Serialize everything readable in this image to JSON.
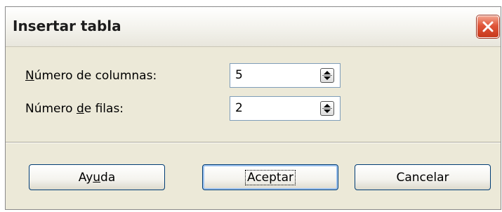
{
  "dialog": {
    "title": "Insertar tabla"
  },
  "fields": {
    "columns": {
      "label_pre": "",
      "label_accel": "N",
      "label_post": "úmero de columnas:",
      "value": "5"
    },
    "rows": {
      "label_pre": "Número ",
      "label_accel": "d",
      "label_post": "e filas:",
      "value": "2"
    }
  },
  "buttons": {
    "help_pre": "Ay",
    "help_accel": "u",
    "help_post": "da",
    "ok": "Aceptar",
    "cancel": "Cancelar"
  },
  "colors": {
    "dialog_bg": "#ece9d8",
    "close_red": "#e0563a",
    "button_border": "#003c74",
    "default_glow": "#9ec3f0"
  },
  "icons": [
    "close-icon",
    "spin-arrows-icon"
  ]
}
